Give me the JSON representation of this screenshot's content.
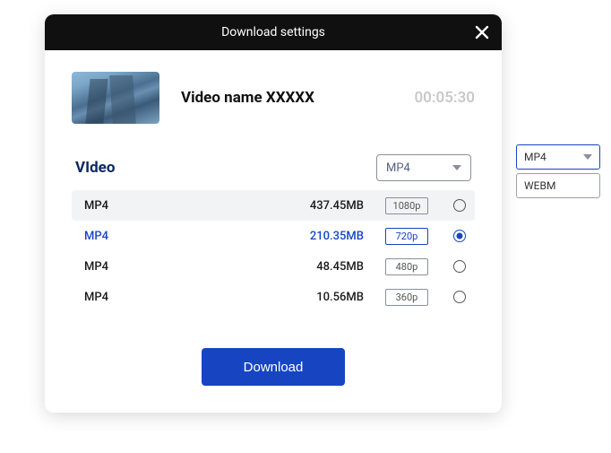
{
  "dialog": {
    "title": "Download settings",
    "video_name": "Video name XXXXX",
    "duration": "00:05:30",
    "section_label": "VIdeo",
    "format_selected": "MP4",
    "download_label": "Download",
    "options": [
      {
        "format": "MP4",
        "size": "437.45MB",
        "res": "1080p",
        "selected": false,
        "highlighted": true
      },
      {
        "format": "MP4",
        "size": "210.35MB",
        "res": "720p",
        "selected": true,
        "highlighted": false
      },
      {
        "format": "MP4",
        "size": "48.45MB",
        "res": "480p",
        "selected": false,
        "highlighted": false
      },
      {
        "format": "MP4",
        "size": "10.56MB",
        "res": "360p",
        "selected": false,
        "highlighted": false
      }
    ]
  },
  "side_dropdown": {
    "selected": "MP4",
    "menu_item": "WEBM"
  }
}
